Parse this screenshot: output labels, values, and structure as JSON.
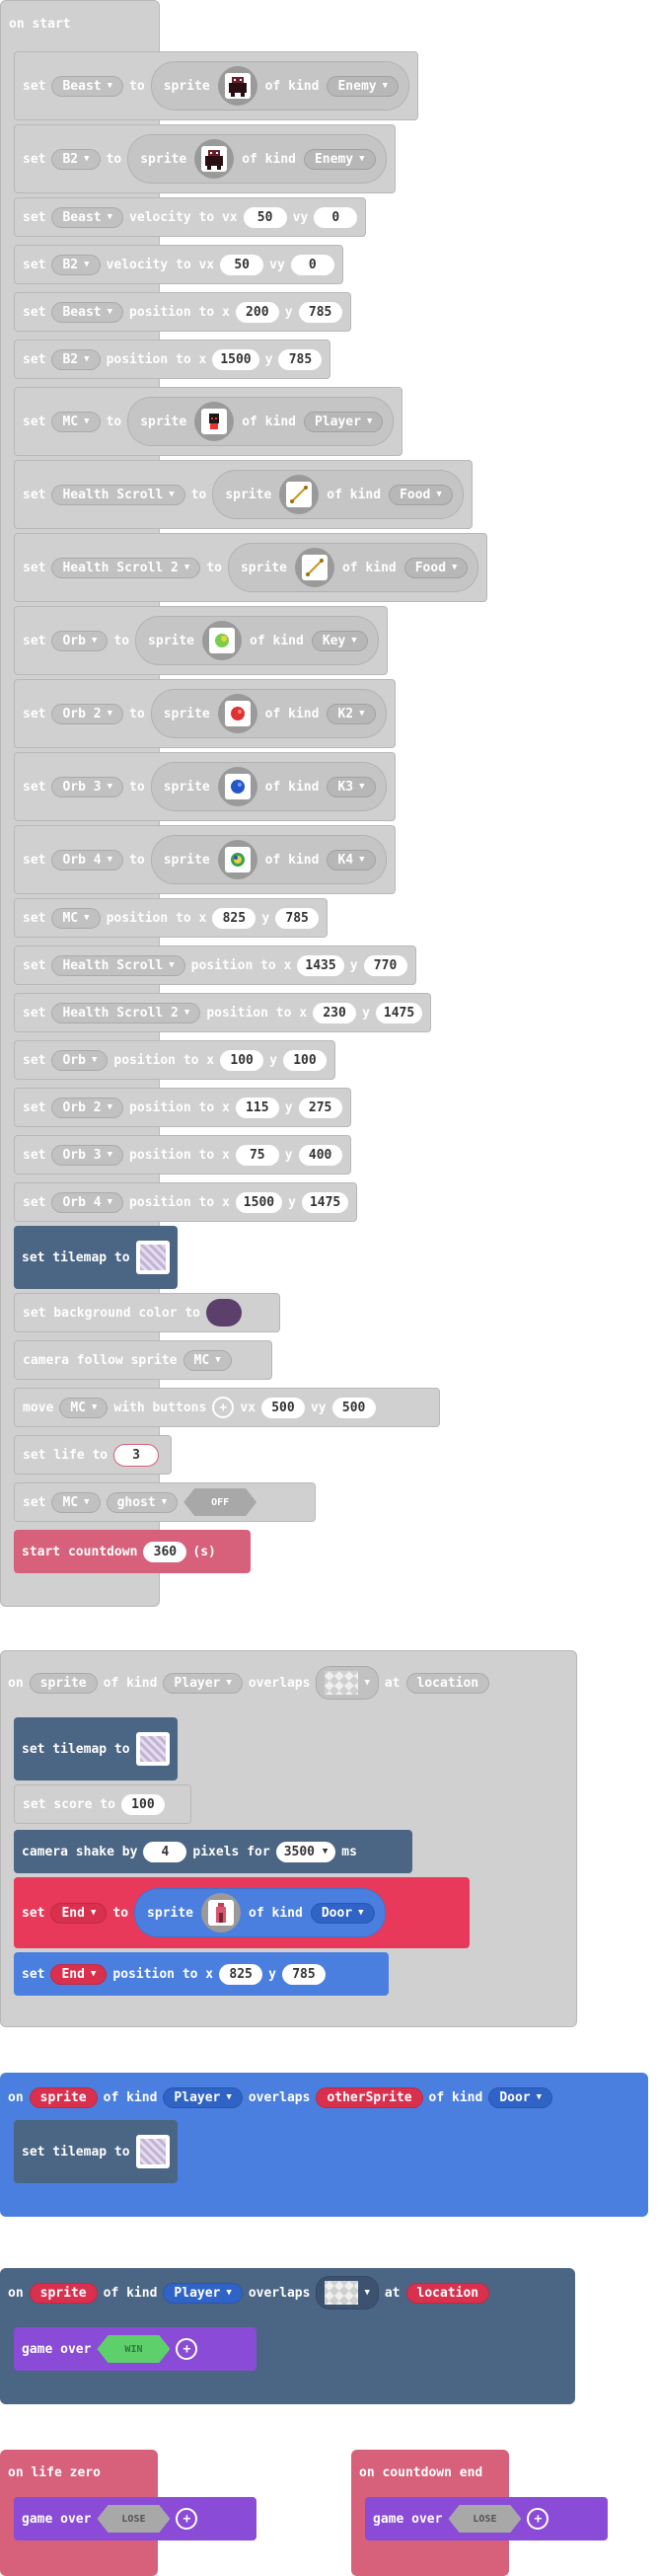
{
  "on_start": {
    "label": "on start",
    "rows": [
      {
        "kind": "set_sprite",
        "var": "Beast",
        "sprite": "beast",
        "kind_val": "Enemy"
      },
      {
        "kind": "set_sprite",
        "var": "B2",
        "sprite": "beast",
        "kind_val": "Enemy"
      },
      {
        "kind": "vel",
        "var": "Beast",
        "vx": "50",
        "vy": "0"
      },
      {
        "kind": "vel",
        "var": "B2",
        "vx": "50",
        "vy": "0"
      },
      {
        "kind": "pos",
        "var": "Beast",
        "x": "200",
        "y": "785"
      },
      {
        "kind": "pos",
        "var": "B2",
        "x": "1500",
        "y": "785"
      },
      {
        "kind": "set_sprite",
        "var": "MC",
        "sprite": "mc",
        "kind_val": "Player"
      },
      {
        "kind": "set_sprite",
        "var": "Health Scroll",
        "sprite": "scroll",
        "kind_val": "Food"
      },
      {
        "kind": "set_sprite",
        "var": "Health Scroll 2",
        "sprite": "scroll",
        "kind_val": "Food"
      },
      {
        "kind": "set_sprite",
        "var": "Orb",
        "sprite": "orb-green",
        "kind_val": "Key"
      },
      {
        "kind": "set_sprite",
        "var": "Orb 2",
        "sprite": "orb-red",
        "kind_val": "K2"
      },
      {
        "kind": "set_sprite",
        "var": "Orb 3",
        "sprite": "orb-blue",
        "kind_val": "K3"
      },
      {
        "kind": "set_sprite",
        "var": "Orb 4",
        "sprite": "orb-multi",
        "kind_val": "K4"
      },
      {
        "kind": "pos",
        "var": "MC",
        "x": "825",
        "y": "785"
      },
      {
        "kind": "pos",
        "var": "Health Scroll",
        "x": "1435",
        "y": "770"
      },
      {
        "kind": "pos",
        "var": "Health Scroll 2",
        "x": "230",
        "y": "1475"
      },
      {
        "kind": "pos",
        "var": "Orb",
        "x": "100",
        "y": "100"
      },
      {
        "kind": "pos",
        "var": "Orb 2",
        "x": "115",
        "y": "275"
      },
      {
        "kind": "pos",
        "var": "Orb 3",
        "x": "75",
        "y": "400"
      },
      {
        "kind": "pos",
        "var": "Orb 4",
        "x": "1500",
        "y": "1475"
      }
    ],
    "set_tilemap": "set tilemap to",
    "set_bg": "set background color to",
    "bg_color": "#5c3f6b",
    "camera_follow": "camera follow sprite",
    "camera_follow_var": "MC",
    "move": "move",
    "move_var": "MC",
    "move_with": "with buttons",
    "move_vx_label": "vx",
    "move_vx": "500",
    "move_vy_label": "vy",
    "move_vy": "500",
    "set_life": "set life to",
    "life": "3",
    "set_ghost_set": "set",
    "ghost_var": "MC",
    "ghost_flag": "ghost",
    "ghost_val": "OFF",
    "countdown": "start countdown",
    "countdown_val": "360",
    "countdown_unit": "(s)"
  },
  "words": {
    "set": "set",
    "to": "to",
    "sprite": "sprite",
    "of_kind": "of kind",
    "velocity_to_vx": "velocity to vx",
    "vy": "vy",
    "position_to_x": "position to x",
    "y": "y"
  },
  "overlap1": {
    "on": "on",
    "sprite": "sprite",
    "of_kind": "of kind",
    "kind": "Player",
    "overlaps": "overlaps",
    "at": "at",
    "location": "location",
    "set_tilemap": "set tilemap to",
    "set_score": "set score to",
    "score": "100",
    "camera_shake": "camera shake by",
    "shake_amt": "4",
    "pixels_for": "pixels for",
    "shake_ms": "3500",
    "ms": "ms",
    "set": "set",
    "end_var": "End",
    "to": "to",
    "sprite_word": "sprite",
    "of_kind2": "of kind",
    "end_kind": "Door",
    "pos_set": "set",
    "pos_var": "End",
    "pos_to_x": "position to x",
    "pos_x": "825",
    "pos_y_label": "y",
    "pos_y": "785"
  },
  "overlap2": {
    "on": "on",
    "sprite": "sprite",
    "of_kind": "of kind",
    "kind": "Player",
    "overlaps": "overlaps",
    "other": "otherSprite",
    "of_kind2": "of kind",
    "kind2": "Door",
    "set_tilemap": "set tilemap to"
  },
  "overlap3": {
    "on": "on",
    "sprite": "sprite",
    "of_kind": "of kind",
    "kind": "Player",
    "overlaps": "overlaps",
    "at": "at",
    "location": "location",
    "game_over": "game over",
    "win": "WIN"
  },
  "life_zero": {
    "label": "on life zero",
    "game_over": "game over",
    "lose": "LOSE"
  },
  "countdown_end": {
    "label": "on countdown end",
    "game_over": "game over",
    "lose": "LOSE"
  },
  "colors": {
    "gray": "#d0d0d0",
    "slate": "#4b6584",
    "pink": "#d7607a",
    "red": "#e8395a",
    "blue": "#4a7fe0",
    "purple": "#8a4bd6"
  }
}
